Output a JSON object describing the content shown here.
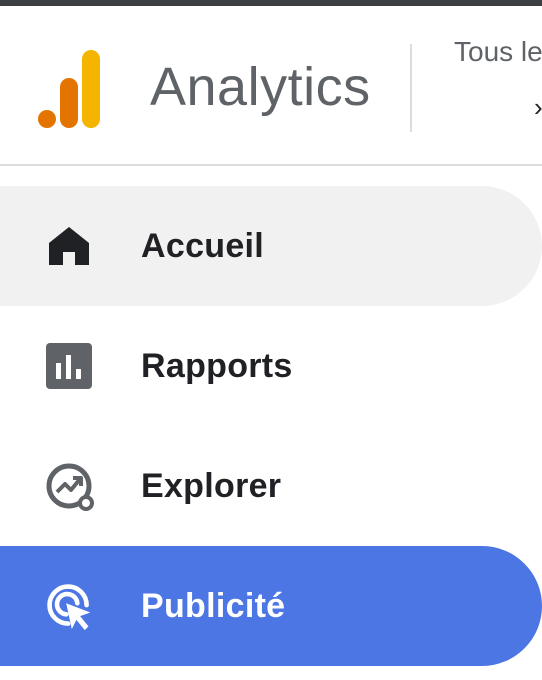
{
  "header": {
    "app_title": "Analytics",
    "account_label": "Tous le",
    "account_chevron": "›",
    "logo_icon": "analytics-logo-icon",
    "accent_colors": {
      "logo_dark": "#e37400",
      "logo_light": "#f9ab00"
    }
  },
  "nav": {
    "items": [
      {
        "label": "Accueil",
        "icon": "home-icon",
        "state": "hover"
      },
      {
        "label": "Rapports",
        "icon": "reports-icon",
        "state": "default"
      },
      {
        "label": "Explorer",
        "icon": "explore-icon",
        "state": "default"
      },
      {
        "label": "Publicité",
        "icon": "advertising-icon",
        "state": "selected"
      }
    ],
    "colors": {
      "selected_bg": "#4c76e3",
      "hover_bg": "#f1f1f1",
      "icon": "#5f6368"
    }
  }
}
